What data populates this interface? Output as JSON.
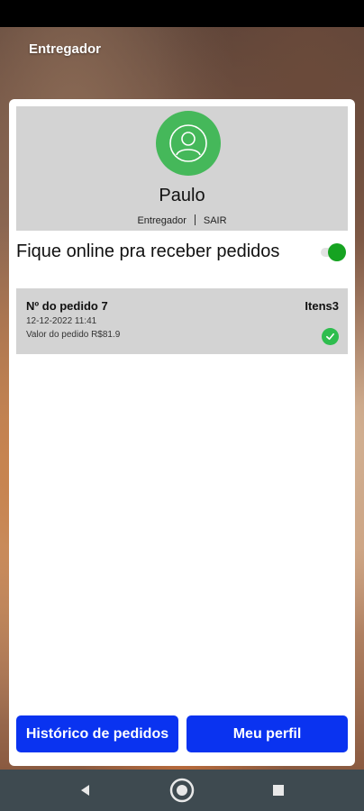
{
  "app": {
    "title": "Entregador"
  },
  "profile": {
    "name": "Paulo",
    "role": "Entregador",
    "logout_label": "SAIR"
  },
  "online": {
    "label": "Fique online pra receber pedidos",
    "enabled": true
  },
  "orders": [
    {
      "title": "Nº do pedido 7",
      "items": "Itens3",
      "datetime": "12-12-2022 11:41",
      "value": "Valor do pedido R$81.9",
      "status": "check-icon"
    }
  ],
  "buttons": {
    "history_label": "Histórico de pedidos",
    "profile_label": "Meu perfil"
  },
  "colors": {
    "accent": "#0a33f0",
    "avatar": "#45b85a",
    "toggle_on": "#16a321",
    "check": "#2ebd4e",
    "card_gray": "#d3d3d3",
    "navbar": "#3e4a50"
  }
}
